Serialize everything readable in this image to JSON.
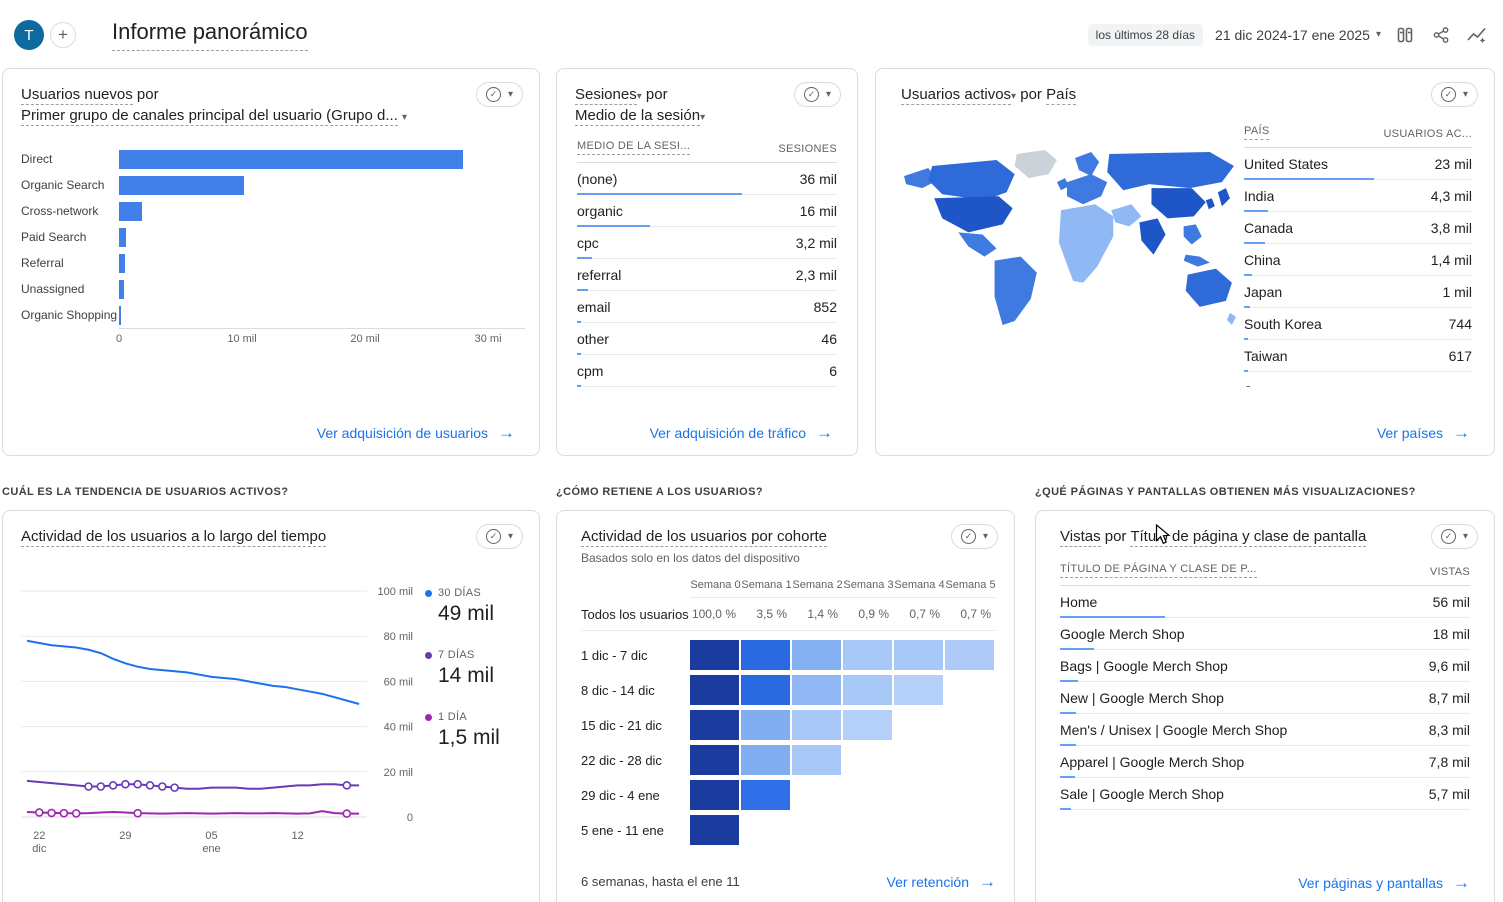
{
  "icons": {
    "plus": "+",
    "check": "✓",
    "caret": "▾",
    "arrow": "→",
    "dash": "-"
  },
  "colors": {
    "accent": "#1a73e8",
    "bar-blue": "#4080e8",
    "minibar": "#669df6",
    "avatar-bg": "#0d6a9e",
    "map-dark": "#1e56c8",
    "map-middark": "#2f6bd8",
    "map-mid": "#3f7ae0",
    "map-light": "#8fb8f5",
    "map-pale": "#c9ddfa",
    "map-gray": "#ccd2d9"
  },
  "header": {
    "avatar_letter": "T",
    "title": "Informe panorámico",
    "date_range_label": "los últimos 28 días",
    "date_range_value": "21 dic 2024-17 ene 2025"
  },
  "sections": {
    "trend": "CUÁL ES LA TENDENCIA DE USUARIOS ACTIVOS?",
    "retention": "¿CÓMO RETIENE A LOS USUARIOS?",
    "pages": "¿QUÉ PÁGINAS Y PANTALLAS OBTIENEN MÁS VISUALIZACIONES?"
  },
  "cards": {
    "new_users": {
      "metric": "Usuarios nuevos",
      "connector": " por",
      "dimension": "Primer grupo de canales principal del usuario (Grupo d...",
      "link": "Ver adquisición de usuarios"
    },
    "sessions": {
      "metric": "Sesiones",
      "connector": " por",
      "dimension": "Medio de la sesión",
      "link": "Ver adquisición de tráfico"
    },
    "countries": {
      "metric": "Usuarios activos",
      "connector": " por ",
      "dimension": "País",
      "link": "Ver países"
    },
    "trend": {
      "title": "Actividad de los usuarios a lo largo del tiempo"
    },
    "cohort": {
      "title": "Actividad de los usuarios por cohorte",
      "subtitle": "Basados solo en los datos del dispositivo",
      "footer": "6 semanas, hasta el ene 11",
      "link": "Ver retención"
    },
    "pages": {
      "metric": "Vistas",
      "connector": " por ",
      "dimension": "Título de página y clase de pantalla",
      "link": "Ver páginas y pantallas"
    }
  },
  "chart_data": [
    {
      "id": "new_users_by_channel",
      "type": "bar",
      "orientation": "horizontal",
      "title": "Usuarios nuevos por primer grupo de canales principal del usuario",
      "categories": [
        "Direct",
        "Organic Search",
        "Cross-network",
        "Paid Search",
        "Referral",
        "Unassigned",
        "Organic Shopping"
      ],
      "values": [
        28000,
        10200,
        1900,
        600,
        450,
        400,
        150
      ],
      "xlim": [
        0,
        33000
      ],
      "xticks": [
        {
          "value": 0,
          "label": "0"
        },
        {
          "value": 10000,
          "label": "10 mil"
        },
        {
          "value": 20000,
          "label": "20 mil"
        },
        {
          "value": 30000,
          "label": "30 mi"
        }
      ]
    },
    {
      "id": "sessions_by_medium",
      "type": "table",
      "columns": [
        "MEDIO DE LA SESI...",
        "SESIONES"
      ],
      "rows": [
        {
          "label": "(none)",
          "display": "36 mil",
          "value": 36000
        },
        {
          "label": "organic",
          "display": "16 mil",
          "value": 16000
        },
        {
          "label": "cpc",
          "display": "3,2 mil",
          "value": 3200
        },
        {
          "label": "referral",
          "display": "2,3 mil",
          "value": 2300
        },
        {
          "label": "email",
          "display": "852",
          "value": 852
        },
        {
          "label": "other",
          "display": "46",
          "value": 46
        },
        {
          "label": "cpm",
          "display": "6",
          "value": 6
        }
      ]
    },
    {
      "id": "active_users_by_country",
      "type": "table",
      "columns": [
        "PAÍS",
        "USUARIOS AC..."
      ],
      "rows": [
        {
          "label": "United States",
          "display": "23 mil",
          "value": 23000
        },
        {
          "label": "India",
          "display": "4,3 mil",
          "value": 4300
        },
        {
          "label": "Canada",
          "display": "3,8 mil",
          "value": 3800
        },
        {
          "label": "China",
          "display": "1,4 mil",
          "value": 1400
        },
        {
          "label": "Japan",
          "display": "1 mil",
          "value": 1000
        },
        {
          "label": "South Korea",
          "display": "744",
          "value": 744
        },
        {
          "label": "Taiwan",
          "display": "617",
          "value": 617
        }
      ]
    },
    {
      "id": "active_users_over_time",
      "type": "line",
      "title": "Actividad de los usuarios a lo largo del tiempo",
      "unit": "mil",
      "ylim": [
        0,
        100
      ],
      "yticks": [
        "100 mil",
        "80 mil",
        "60 mil",
        "40 mil",
        "20 mil",
        "0"
      ],
      "xticks": [
        {
          "index": 1,
          "label": "22\ndic"
        },
        {
          "index": 8,
          "label": "29"
        },
        {
          "index": 15,
          "label": "05\nene"
        },
        {
          "index": 22,
          "label": "12"
        }
      ],
      "series": [
        {
          "name": "30 DÍAS",
          "current": "49 mil",
          "color": "#1a73e8",
          "values": [
            78,
            77,
            76,
            75.5,
            75,
            74,
            72.5,
            70,
            68,
            66.5,
            65.5,
            65,
            64.5,
            64,
            63,
            62,
            61.5,
            61,
            60,
            59,
            58,
            57.5,
            56.5,
            55.5,
            54.5,
            53,
            51.5,
            50
          ],
          "markers": []
        },
        {
          "name": "7 DÍAS",
          "current": "14 mil",
          "color": "#673ab7",
          "values": [
            16,
            15.5,
            15,
            14.5,
            14,
            13.5,
            13.5,
            14,
            14.5,
            14.5,
            14,
            13.5,
            13,
            12.5,
            12.5,
            13,
            13,
            13,
            12.5,
            12.5,
            13,
            13.5,
            14,
            14,
            14.5,
            14.5,
            14,
            14
          ],
          "markers": [
            5,
            6,
            7,
            8,
            9,
            10,
            11,
            12,
            26
          ]
        },
        {
          "name": "1 DÍA",
          "current": "1,5 mil",
          "color": "#9c27b0",
          "values": [
            2.2,
            2,
            1.8,
            1.7,
            1.6,
            1.7,
            2,
            2.2,
            2,
            1.7,
            1.6,
            1.5,
            1.6,
            1.7,
            1.6,
            1.5,
            1.6,
            1.7,
            1.6,
            1.6,
            1.7,
            1.6,
            1.5,
            1.6,
            2.6,
            1.7,
            1.5,
            1.5
          ],
          "markers": [
            1,
            2,
            3,
            4,
            9,
            26
          ]
        }
      ]
    },
    {
      "id": "cohort_activity",
      "type": "heatmap",
      "title": "Actividad de los usuarios por cohorte",
      "columns": [
        "Semana 0",
        "Semana 1",
        "Semana 2",
        "Semana 3",
        "Semana 4",
        "Semana 5"
      ],
      "summary": {
        "label": "Todos los usuarios",
        "values": [
          "100,0 %",
          "3,5 %",
          "1,4 %",
          "0,9 %",
          "0,7 %",
          "0,7 %"
        ]
      },
      "rows": [
        {
          "label": "1 dic - 7 dic",
          "cells": [
            "#1b3b9e",
            "#2a6ae0",
            "#85b0f2",
            "#a7c7f7",
            "#a7c7f7",
            "#adcaf8"
          ]
        },
        {
          "label": "8 dic - 14 dic",
          "cells": [
            "#1b3b9e",
            "#2a6ae0",
            "#90b7f4",
            "#a7c7f7",
            "#b5d0f8"
          ]
        },
        {
          "label": "15 dic - 21 dic",
          "cells": [
            "#1b3b9e",
            "#81adf1",
            "#a7c7f7",
            "#b5d0f8"
          ]
        },
        {
          "label": "22 dic - 28 dic",
          "cells": [
            "#1b3b9e",
            "#81adf1",
            "#a7c7f7"
          ]
        },
        {
          "label": "29 dic - 4 ene",
          "cells": [
            "#1b3b9e",
            "#2f6fe8"
          ]
        },
        {
          "label": "5 ene - 11 ene",
          "cells": [
            "#1b3b9e"
          ]
        }
      ],
      "footer": "6 semanas, hasta el ene 11"
    },
    {
      "id": "views_by_page",
      "type": "table",
      "columns": [
        "TÍTULO DE PÁGINA Y CLASE DE P...",
        "VISTAS"
      ],
      "rows": [
        {
          "label": "Home",
          "display": "56 mil",
          "value": 56000
        },
        {
          "label": "Google Merch Shop",
          "display": "18 mil",
          "value": 18000
        },
        {
          "label": "Bags | Google Merch Shop",
          "display": "9,6 mil",
          "value": 9600
        },
        {
          "label": "New | Google Merch Shop",
          "display": "8,7 mil",
          "value": 8700
        },
        {
          "label": "Men's / Unisex | Google Merch Shop",
          "display": "8,3 mil",
          "value": 8300
        },
        {
          "label": "Apparel | Google Merch Shop",
          "display": "7,8 mil",
          "value": 7800
        },
        {
          "label": "Sale | Google Merch Shop",
          "display": "5,7 mil",
          "value": 5700
        }
      ]
    }
  ]
}
